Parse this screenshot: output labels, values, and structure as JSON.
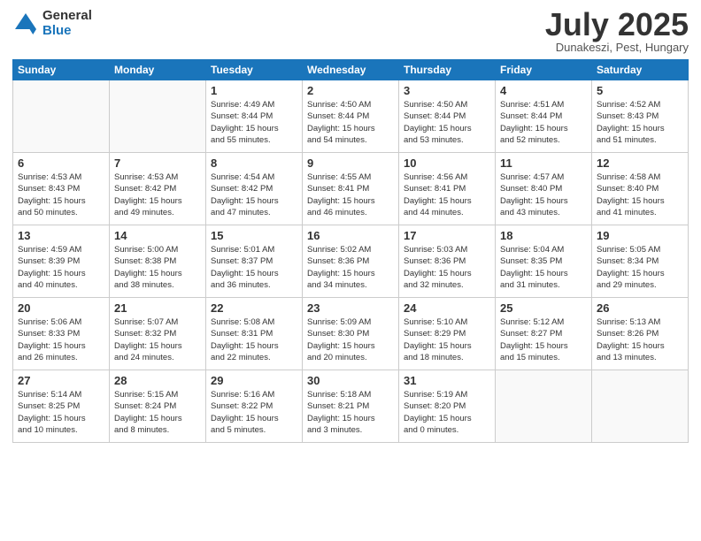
{
  "logo": {
    "general": "General",
    "blue": "Blue"
  },
  "title": "July 2025",
  "location": "Dunakeszi, Pest, Hungary",
  "days_header": [
    "Sunday",
    "Monday",
    "Tuesday",
    "Wednesday",
    "Thursday",
    "Friday",
    "Saturday"
  ],
  "weeks": [
    [
      {
        "day": "",
        "info": ""
      },
      {
        "day": "",
        "info": ""
      },
      {
        "day": "1",
        "info": "Sunrise: 4:49 AM\nSunset: 8:44 PM\nDaylight: 15 hours\nand 55 minutes."
      },
      {
        "day": "2",
        "info": "Sunrise: 4:50 AM\nSunset: 8:44 PM\nDaylight: 15 hours\nand 54 minutes."
      },
      {
        "day": "3",
        "info": "Sunrise: 4:50 AM\nSunset: 8:44 PM\nDaylight: 15 hours\nand 53 minutes."
      },
      {
        "day": "4",
        "info": "Sunrise: 4:51 AM\nSunset: 8:44 PM\nDaylight: 15 hours\nand 52 minutes."
      },
      {
        "day": "5",
        "info": "Sunrise: 4:52 AM\nSunset: 8:43 PM\nDaylight: 15 hours\nand 51 minutes."
      }
    ],
    [
      {
        "day": "6",
        "info": "Sunrise: 4:53 AM\nSunset: 8:43 PM\nDaylight: 15 hours\nand 50 minutes."
      },
      {
        "day": "7",
        "info": "Sunrise: 4:53 AM\nSunset: 8:42 PM\nDaylight: 15 hours\nand 49 minutes."
      },
      {
        "day": "8",
        "info": "Sunrise: 4:54 AM\nSunset: 8:42 PM\nDaylight: 15 hours\nand 47 minutes."
      },
      {
        "day": "9",
        "info": "Sunrise: 4:55 AM\nSunset: 8:41 PM\nDaylight: 15 hours\nand 46 minutes."
      },
      {
        "day": "10",
        "info": "Sunrise: 4:56 AM\nSunset: 8:41 PM\nDaylight: 15 hours\nand 44 minutes."
      },
      {
        "day": "11",
        "info": "Sunrise: 4:57 AM\nSunset: 8:40 PM\nDaylight: 15 hours\nand 43 minutes."
      },
      {
        "day": "12",
        "info": "Sunrise: 4:58 AM\nSunset: 8:40 PM\nDaylight: 15 hours\nand 41 minutes."
      }
    ],
    [
      {
        "day": "13",
        "info": "Sunrise: 4:59 AM\nSunset: 8:39 PM\nDaylight: 15 hours\nand 40 minutes."
      },
      {
        "day": "14",
        "info": "Sunrise: 5:00 AM\nSunset: 8:38 PM\nDaylight: 15 hours\nand 38 minutes."
      },
      {
        "day": "15",
        "info": "Sunrise: 5:01 AM\nSunset: 8:37 PM\nDaylight: 15 hours\nand 36 minutes."
      },
      {
        "day": "16",
        "info": "Sunrise: 5:02 AM\nSunset: 8:36 PM\nDaylight: 15 hours\nand 34 minutes."
      },
      {
        "day": "17",
        "info": "Sunrise: 5:03 AM\nSunset: 8:36 PM\nDaylight: 15 hours\nand 32 minutes."
      },
      {
        "day": "18",
        "info": "Sunrise: 5:04 AM\nSunset: 8:35 PM\nDaylight: 15 hours\nand 31 minutes."
      },
      {
        "day": "19",
        "info": "Sunrise: 5:05 AM\nSunset: 8:34 PM\nDaylight: 15 hours\nand 29 minutes."
      }
    ],
    [
      {
        "day": "20",
        "info": "Sunrise: 5:06 AM\nSunset: 8:33 PM\nDaylight: 15 hours\nand 26 minutes."
      },
      {
        "day": "21",
        "info": "Sunrise: 5:07 AM\nSunset: 8:32 PM\nDaylight: 15 hours\nand 24 minutes."
      },
      {
        "day": "22",
        "info": "Sunrise: 5:08 AM\nSunset: 8:31 PM\nDaylight: 15 hours\nand 22 minutes."
      },
      {
        "day": "23",
        "info": "Sunrise: 5:09 AM\nSunset: 8:30 PM\nDaylight: 15 hours\nand 20 minutes."
      },
      {
        "day": "24",
        "info": "Sunrise: 5:10 AM\nSunset: 8:29 PM\nDaylight: 15 hours\nand 18 minutes."
      },
      {
        "day": "25",
        "info": "Sunrise: 5:12 AM\nSunset: 8:27 PM\nDaylight: 15 hours\nand 15 minutes."
      },
      {
        "day": "26",
        "info": "Sunrise: 5:13 AM\nSunset: 8:26 PM\nDaylight: 15 hours\nand 13 minutes."
      }
    ],
    [
      {
        "day": "27",
        "info": "Sunrise: 5:14 AM\nSunset: 8:25 PM\nDaylight: 15 hours\nand 10 minutes."
      },
      {
        "day": "28",
        "info": "Sunrise: 5:15 AM\nSunset: 8:24 PM\nDaylight: 15 hours\nand 8 minutes."
      },
      {
        "day": "29",
        "info": "Sunrise: 5:16 AM\nSunset: 8:22 PM\nDaylight: 15 hours\nand 5 minutes."
      },
      {
        "day": "30",
        "info": "Sunrise: 5:18 AM\nSunset: 8:21 PM\nDaylight: 15 hours\nand 3 minutes."
      },
      {
        "day": "31",
        "info": "Sunrise: 5:19 AM\nSunset: 8:20 PM\nDaylight: 15 hours\nand 0 minutes."
      },
      {
        "day": "",
        "info": ""
      },
      {
        "day": "",
        "info": ""
      }
    ]
  ]
}
